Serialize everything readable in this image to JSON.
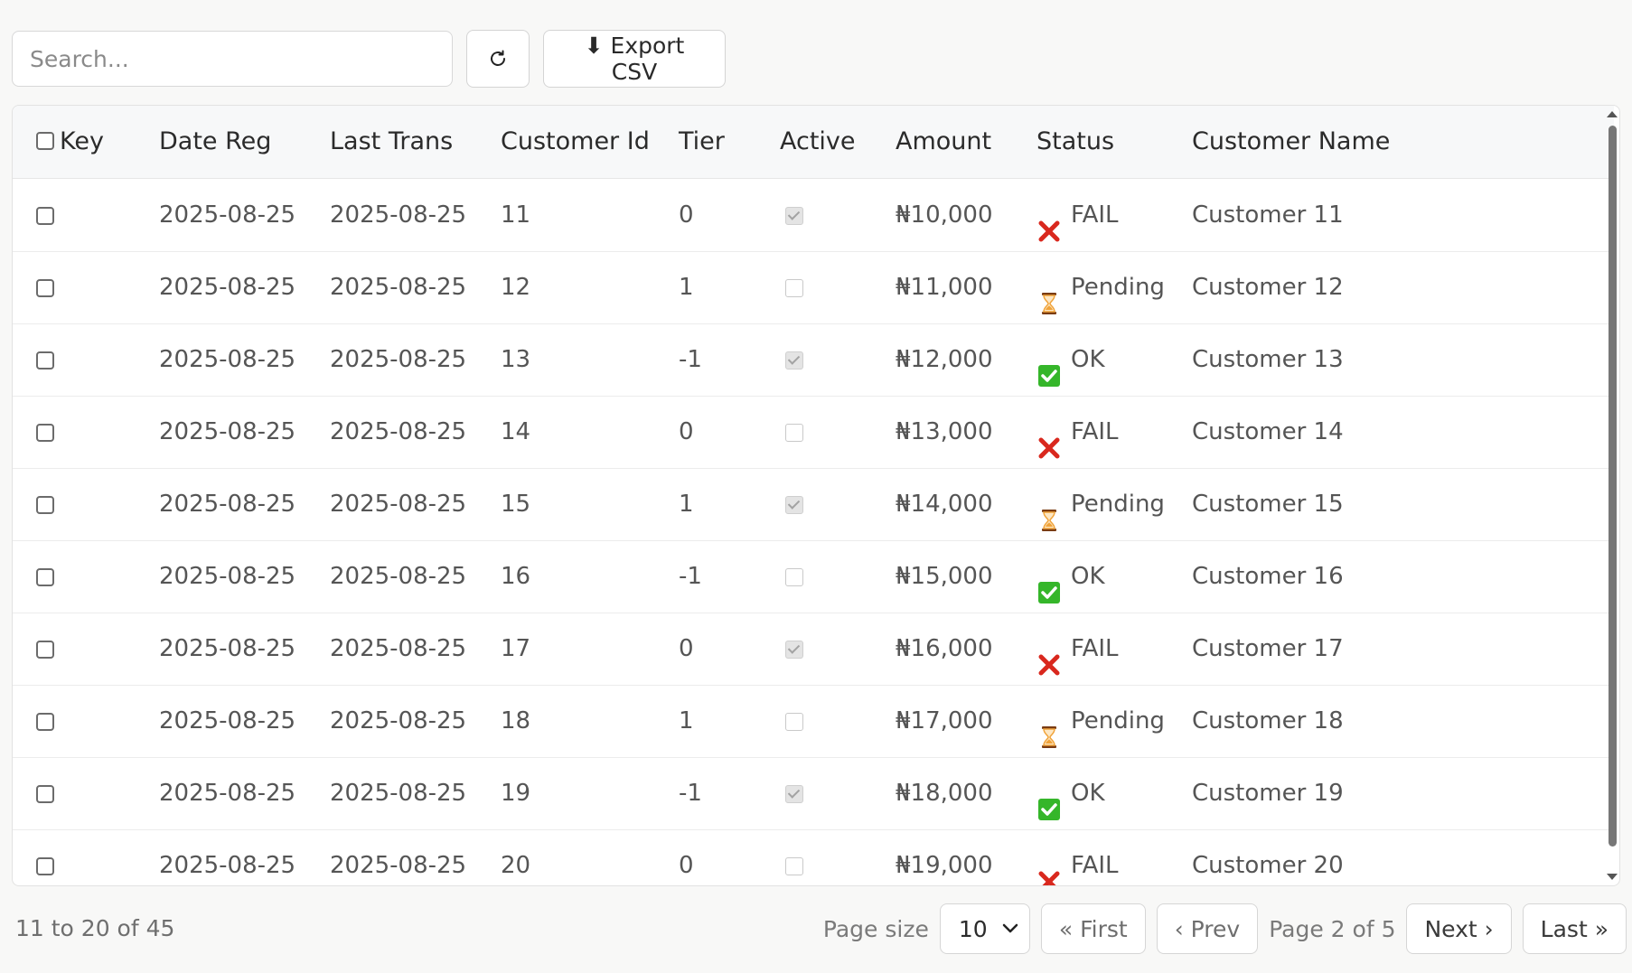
{
  "toolbar": {
    "search_placeholder": "Search...",
    "refresh_icon": "refresh-icon",
    "export_label": "⬇ Export CSV"
  },
  "table": {
    "columns": [
      "Key",
      "Date Reg",
      "Last Trans",
      "Customer Id",
      "Tier",
      "Active",
      "Amount",
      "Status",
      "Customer Name"
    ],
    "rows": [
      {
        "date_reg": "2025-08-25",
        "last_trans": "2025-08-25",
        "customer_id": "11",
        "tier": "0",
        "active": true,
        "amount": "₦10,000",
        "status": "FAIL",
        "status_icon": "cross-mark-icon",
        "name": "Customer 11"
      },
      {
        "date_reg": "2025-08-25",
        "last_trans": "2025-08-25",
        "customer_id": "12",
        "tier": "1",
        "active": false,
        "amount": "₦11,000",
        "status": "Pending",
        "status_icon": "hourglass-icon",
        "name": "Customer 12"
      },
      {
        "date_reg": "2025-08-25",
        "last_trans": "2025-08-25",
        "customer_id": "13",
        "tier": "-1",
        "active": true,
        "amount": "₦12,000",
        "status": "OK",
        "status_icon": "check-mark-icon",
        "name": "Customer 13"
      },
      {
        "date_reg": "2025-08-25",
        "last_trans": "2025-08-25",
        "customer_id": "14",
        "tier": "0",
        "active": false,
        "amount": "₦13,000",
        "status": "FAIL",
        "status_icon": "cross-mark-icon",
        "name": "Customer 14"
      },
      {
        "date_reg": "2025-08-25",
        "last_trans": "2025-08-25",
        "customer_id": "15",
        "tier": "1",
        "active": true,
        "amount": "₦14,000",
        "status": "Pending",
        "status_icon": "hourglass-icon",
        "name": "Customer 15"
      },
      {
        "date_reg": "2025-08-25",
        "last_trans": "2025-08-25",
        "customer_id": "16",
        "tier": "-1",
        "active": false,
        "amount": "₦15,000",
        "status": "OK",
        "status_icon": "check-mark-icon",
        "name": "Customer 16"
      },
      {
        "date_reg": "2025-08-25",
        "last_trans": "2025-08-25",
        "customer_id": "17",
        "tier": "0",
        "active": true,
        "amount": "₦16,000",
        "status": "FAIL",
        "status_icon": "cross-mark-icon",
        "name": "Customer 17"
      },
      {
        "date_reg": "2025-08-25",
        "last_trans": "2025-08-25",
        "customer_id": "18",
        "tier": "1",
        "active": false,
        "amount": "₦17,000",
        "status": "Pending",
        "status_icon": "hourglass-icon",
        "name": "Customer 18"
      },
      {
        "date_reg": "2025-08-25",
        "last_trans": "2025-08-25",
        "customer_id": "19",
        "tier": "-1",
        "active": true,
        "amount": "₦18,000",
        "status": "OK",
        "status_icon": "check-mark-icon",
        "name": "Customer 19"
      },
      {
        "date_reg": "2025-08-25",
        "last_trans": "2025-08-25",
        "customer_id": "20",
        "tier": "0",
        "active": false,
        "amount": "₦19,000",
        "status": "FAIL",
        "status_icon": "cross-mark-icon",
        "name": "Customer 20"
      }
    ]
  },
  "footer": {
    "range_text": "11 to 20 of 45",
    "page_size_label": "Page size",
    "page_size_value": "10",
    "first_label": "« First",
    "prev_label": "‹ Prev",
    "page_text": "Page 2 of 5",
    "next_label": "Next ›",
    "last_label": "Last »"
  },
  "colors": {
    "background": "#f8f8f7",
    "fail_red": "#d9281e",
    "ok_green": "#35b62a",
    "pending_amber": "#f0a33a"
  }
}
